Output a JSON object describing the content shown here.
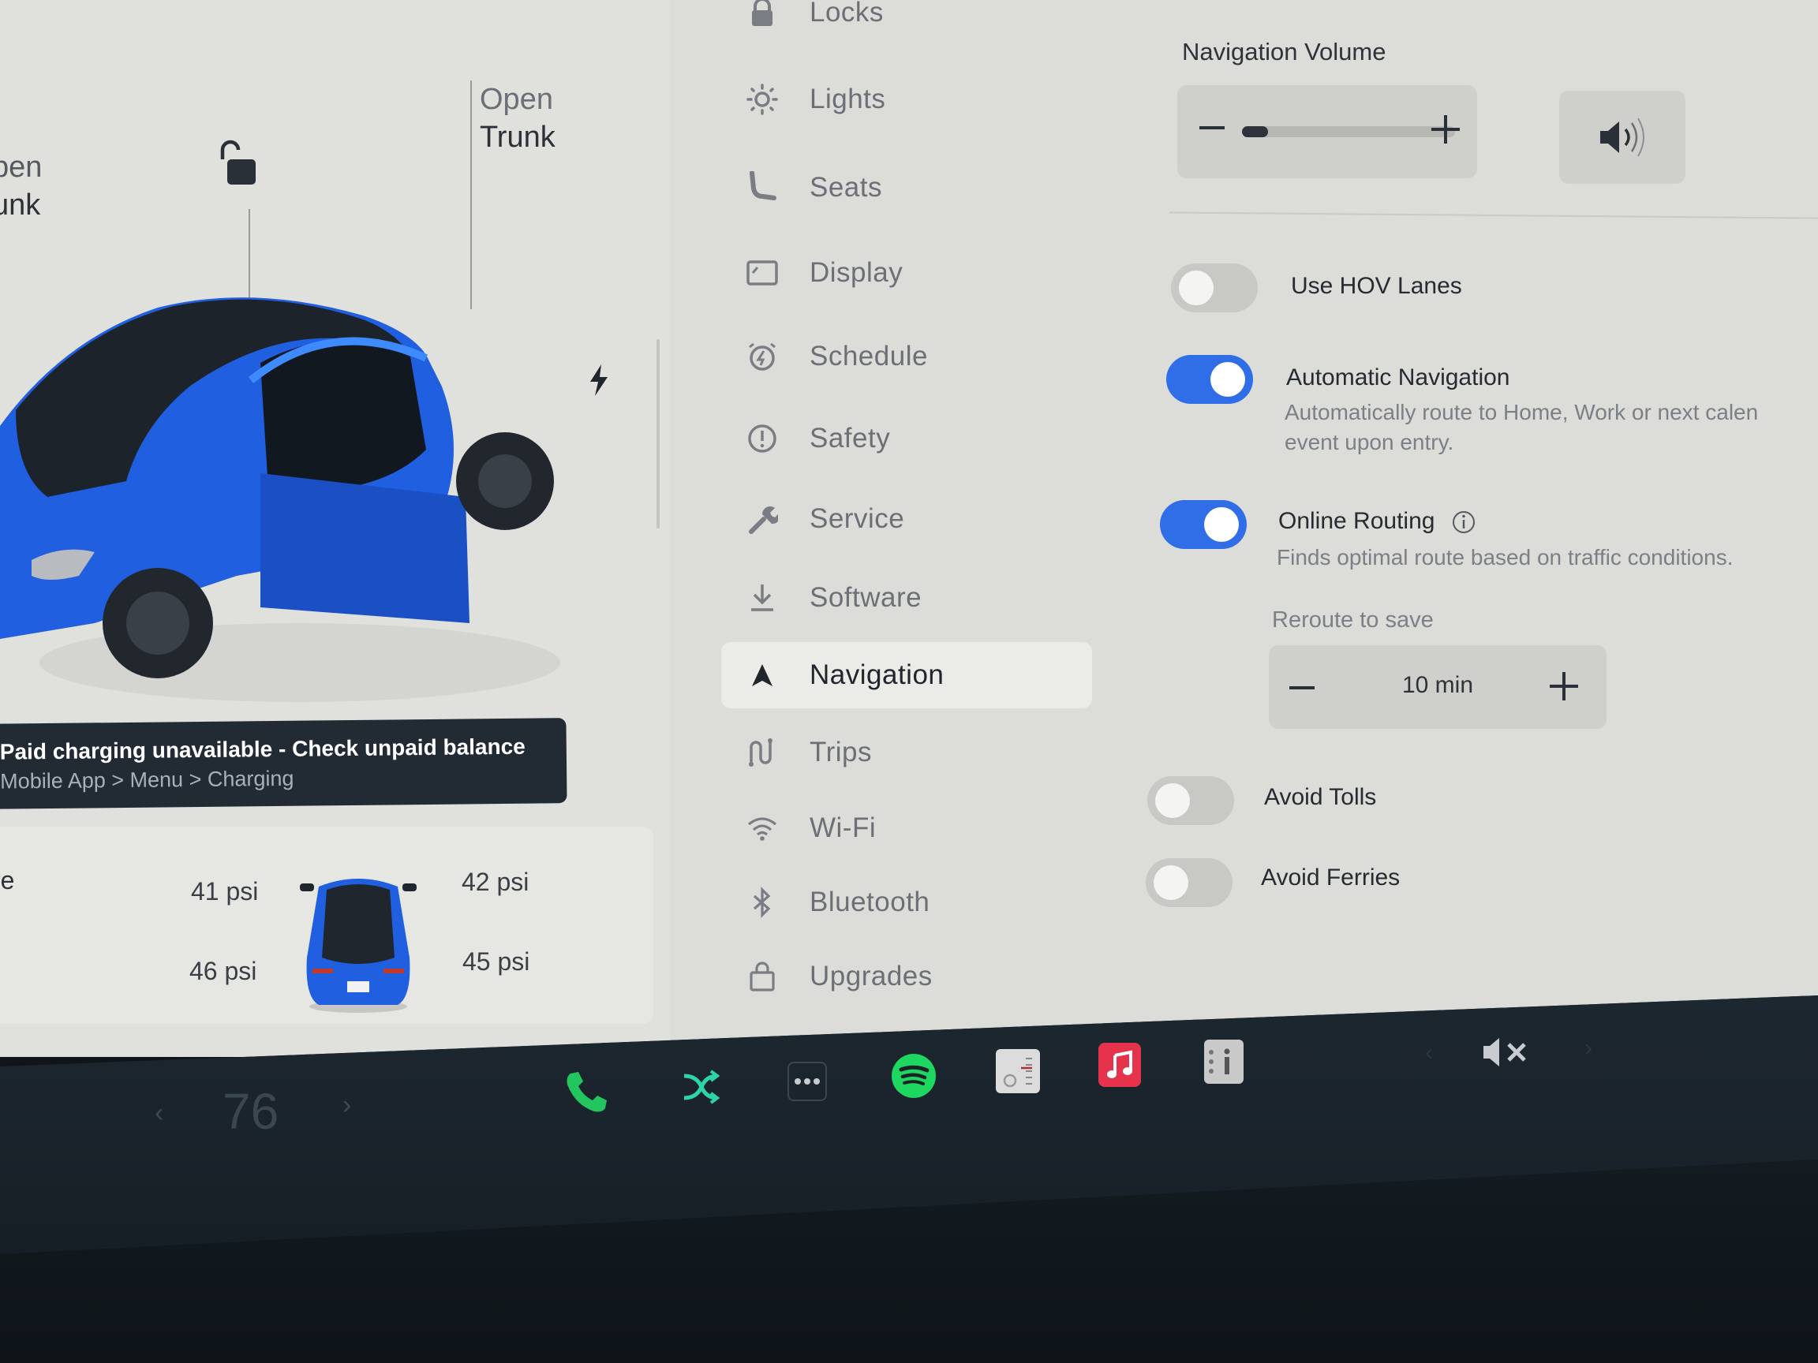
{
  "car": {
    "frunk_left_line1": "pen",
    "frunk_left_line2": "unk",
    "trunk_right_line1": "Open",
    "trunk_right_line2": "Trunk",
    "lock_state": "unlocked",
    "alert": {
      "title": "Paid charging unavailable - Check unpaid balance",
      "subtitle": "Mobile App > Menu > Charging"
    },
    "tires": {
      "label": "re",
      "front_left": "41 psi",
      "front_right": "42 psi",
      "rear_left": "46 psi",
      "rear_right": "45 psi"
    },
    "paint_color": "#1f5fe0"
  },
  "menu": {
    "items": [
      {
        "label": "Locks",
        "icon": "lock-icon",
        "active": false
      },
      {
        "label": "Lights",
        "icon": "sun-icon",
        "active": false
      },
      {
        "label": "Seats",
        "icon": "seat-icon",
        "active": false
      },
      {
        "label": "Display",
        "icon": "display-icon",
        "active": false
      },
      {
        "label": "Schedule",
        "icon": "alarm-clock-icon",
        "active": false
      },
      {
        "label": "Safety",
        "icon": "alert-circle-icon",
        "active": false
      },
      {
        "label": "Service",
        "icon": "wrench-icon",
        "active": false
      },
      {
        "label": "Software",
        "icon": "download-icon",
        "active": false
      },
      {
        "label": "Navigation",
        "icon": "navigation-arrow-icon",
        "active": true
      },
      {
        "label": "Trips",
        "icon": "trips-route-icon",
        "active": false
      },
      {
        "label": "Wi-Fi",
        "icon": "wifi-icon",
        "active": false
      },
      {
        "label": "Bluetooth",
        "icon": "bluetooth-icon",
        "active": false
      },
      {
        "label": "Upgrades",
        "icon": "shopping-bag-icon",
        "active": false
      }
    ]
  },
  "navigation": {
    "volume_label": "Navigation Volume",
    "volume_level_percent": 4,
    "options": {
      "hov": {
        "title": "Use HOV Lanes",
        "enabled": false
      },
      "auto_nav": {
        "title": "Automatic Navigation",
        "desc_line1": "Automatically route to Home, Work or next calen",
        "desc_line2": "event upon entry.",
        "enabled": true
      },
      "online_routing": {
        "title": "Online Routing",
        "desc": "Finds optimal route based on traffic conditions.",
        "enabled": true
      },
      "avoid_tolls": {
        "title": "Avoid Tolls",
        "enabled": false
      },
      "avoid_ferries": {
        "title": "Avoid Ferries",
        "enabled": false
      }
    },
    "reroute": {
      "label": "Reroute to save",
      "value": "10 min"
    },
    "accent_color": "#2f6ee6"
  },
  "dock": {
    "temp_prev": "‹",
    "temperature": "76",
    "temp_next": "›",
    "apps": [
      {
        "name": "phone",
        "icon": "phone-icon"
      },
      {
        "name": "shuffle",
        "icon": "shuffle-icon"
      },
      {
        "name": "more",
        "icon": "more-dots-icon"
      },
      {
        "name": "spotify",
        "icon": "spotify-icon"
      },
      {
        "name": "radio",
        "icon": "radio-icon"
      },
      {
        "name": "apple-music",
        "icon": "apple-music-icon"
      },
      {
        "name": "manual",
        "icon": "manual-info-icon"
      }
    ],
    "volume_prev": "‹",
    "volume_next": "›",
    "volume_state": "muted"
  }
}
